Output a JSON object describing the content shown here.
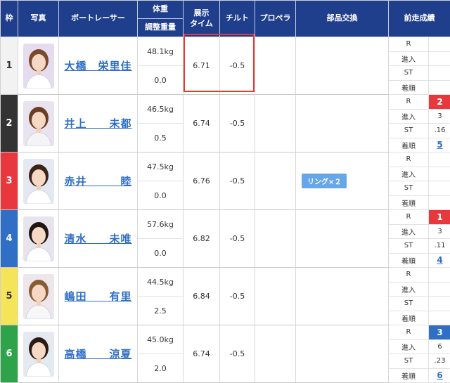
{
  "header": {
    "waku": "枠",
    "photo": "写真",
    "racer": "ボートレーサー",
    "weight": "体重",
    "adjust": "調整重量",
    "exhibit_time": "展示\nタイム",
    "tilt": "チルト",
    "propeller": "プロペラ",
    "parts": "部品交換",
    "prev_results": "前走成績"
  },
  "prev_labels": [
    "R",
    "進入",
    "ST",
    "着順"
  ],
  "colors": {
    "header_bg": "#1f3e8c",
    "waku": [
      "#f2f2f2",
      "#333333",
      "#e8383d",
      "#2f6fc6",
      "#f5e35a",
      "#2fa34a"
    ],
    "link": "#2f6fc6",
    "highlight": "#e63a30",
    "parts_badge": "#67a6e8"
  },
  "racers": [
    {
      "waku": "1",
      "name": "大橋　栄里佳",
      "weight": "48.1kg",
      "adjust": "0.0",
      "exhibit": "6.71",
      "tilt": "-0.5",
      "propeller": "",
      "parts": "",
      "prev": {
        "r": "",
        "entry": "",
        "st": "",
        "rank": "",
        "rank_style": ""
      }
    },
    {
      "waku": "2",
      "name": "井上　　未都",
      "weight": "46.5kg",
      "adjust": "0.5",
      "exhibit": "6.74",
      "tilt": "-0.5",
      "propeller": "",
      "parts": "",
      "prev": {
        "r": "2",
        "entry": "3",
        "st": ".16",
        "rank": "5",
        "rank_style": "red"
      }
    },
    {
      "waku": "3",
      "name": "赤井　　　睦",
      "weight": "47.5kg",
      "adjust": "0.0",
      "exhibit": "6.76",
      "tilt": "-0.5",
      "propeller": "",
      "parts": "リング×２",
      "prev": {
        "r": "",
        "entry": "",
        "st": "",
        "rank": "",
        "rank_style": ""
      }
    },
    {
      "waku": "4",
      "name": "清水　　未唯",
      "weight": "57.6kg",
      "adjust": "0.0",
      "exhibit": "6.82",
      "tilt": "-0.5",
      "propeller": "",
      "parts": "",
      "prev": {
        "r": "1",
        "entry": "3",
        "st": ".11",
        "rank": "4",
        "rank_style": "red"
      }
    },
    {
      "waku": "5",
      "name": "嶋田　　有里",
      "weight": "44.5kg",
      "adjust": "2.5",
      "exhibit": "6.84",
      "tilt": "-0.5",
      "propeller": "",
      "parts": "",
      "prev": {
        "r": "",
        "entry": "",
        "st": "",
        "rank": "",
        "rank_style": ""
      }
    },
    {
      "waku": "6",
      "name": "高橋　　涼夏",
      "weight": "45.0kg",
      "adjust": "2.0",
      "exhibit": "6.74",
      "tilt": "-0.5",
      "propeller": "",
      "parts": "",
      "prev": {
        "r": "3",
        "entry": "6",
        "st": ".23",
        "rank": "6",
        "rank_style": "blue"
      }
    }
  ]
}
